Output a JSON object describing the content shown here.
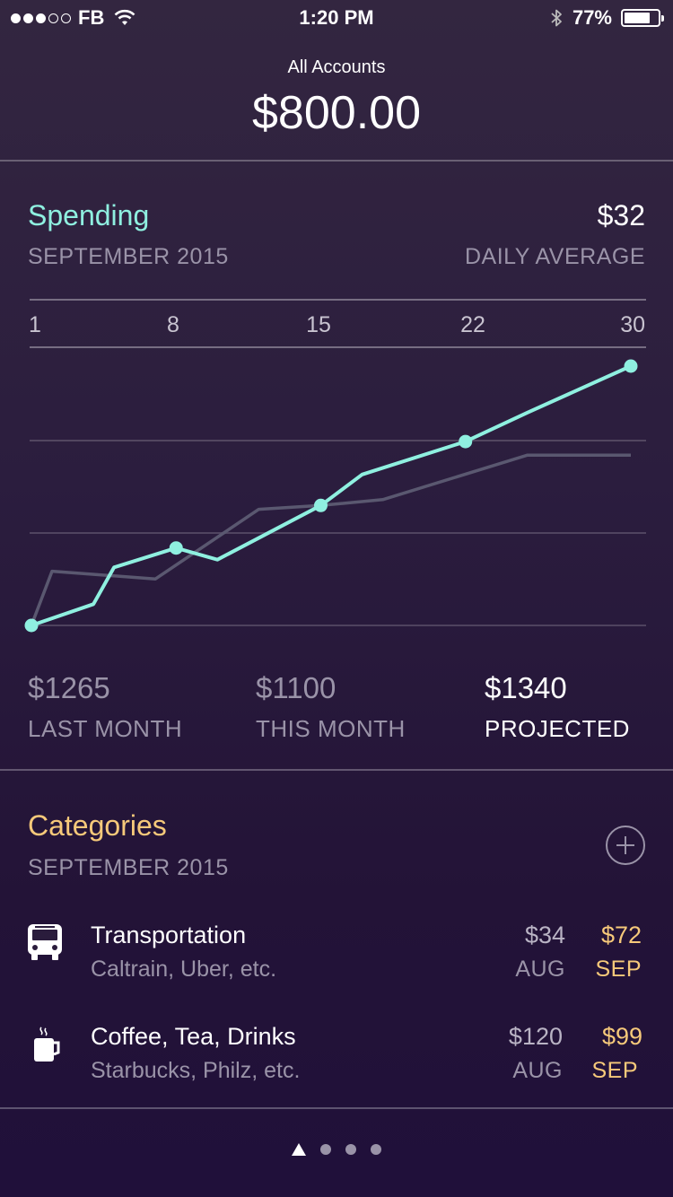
{
  "status_bar": {
    "carrier": "FB",
    "time": "1:20 PM",
    "battery": "77%",
    "battery_level": 0.77,
    "signal_bars": 3,
    "signal_total": 5
  },
  "header": {
    "label": "All Accounts",
    "total": "$800.00"
  },
  "spending": {
    "title": "Spending",
    "month": "SEPTEMBER 2015",
    "daily_average_value": "$32",
    "daily_average_label": "DAILY AVERAGE"
  },
  "chart_data": {
    "type": "line",
    "x_ticks": [
      "1",
      "8",
      "15",
      "22",
      "30"
    ],
    "xlim": [
      1,
      30
    ],
    "series": [
      {
        "role": "this-month",
        "color": "#8ff0e0",
        "markers_at": [
          1,
          8,
          15,
          22,
          30
        ],
        "points": [
          [
            1,
            0
          ],
          [
            4,
            110
          ],
          [
            5,
            300
          ],
          [
            8,
            400
          ],
          [
            10,
            340
          ],
          [
            15,
            620
          ],
          [
            17,
            780
          ],
          [
            22,
            950
          ],
          [
            25,
            1100
          ],
          [
            30,
            1340
          ]
        ]
      },
      {
        "role": "last-month",
        "color": "#5a5870",
        "points": [
          [
            1,
            0
          ],
          [
            2,
            280
          ],
          [
            7,
            240
          ],
          [
            12,
            600
          ],
          [
            15,
            620
          ],
          [
            18,
            650
          ],
          [
            25,
            880
          ],
          [
            30,
            880
          ]
        ]
      }
    ],
    "grid_lines": 4
  },
  "stats": [
    {
      "value": "$1265",
      "label": "LAST MONTH",
      "highlight": false
    },
    {
      "value": "$1100",
      "label": "THIS MONTH",
      "highlight": false
    },
    {
      "value": "$1340",
      "label": "PROJECTED",
      "highlight": true
    }
  ],
  "categories": {
    "title": "Categories",
    "month": "SEPTEMBER 2015",
    "items": [
      {
        "icon": "bus-icon",
        "name": "Transportation",
        "subtitle": "Caltrain, Uber, etc.",
        "prev_amount": "$34",
        "prev_month": "AUG",
        "cur_amount": "$72",
        "cur_month": "SEP"
      },
      {
        "icon": "coffee-cup-icon",
        "name": "Coffee, Tea, Drinks",
        "subtitle": "Starbucks, Philz, etc.",
        "prev_amount": "$120",
        "prev_month": "AUG",
        "cur_amount": "$99",
        "cur_month": "SEP"
      }
    ]
  },
  "pager": {
    "pages": 4,
    "current": 0
  },
  "colors": {
    "spending_accent": "#8ff0e0",
    "categories_accent": "#f6c97a",
    "muted_text": "#9a93a8"
  }
}
